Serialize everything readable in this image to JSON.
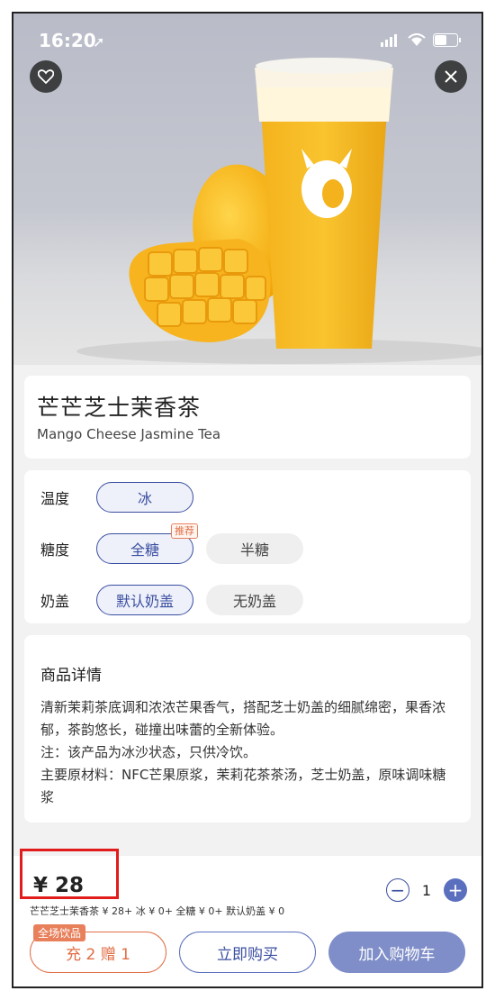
{
  "status_bar": {
    "time": "16:20"
  },
  "product": {
    "name_cn": "芒芒芝士茉香茶",
    "name_en": "Mango Cheese Jasmine Tea",
    "cup_brand": "luckin coffee"
  },
  "options": {
    "temperature": {
      "label": "温度",
      "choices": [
        "冰"
      ],
      "selected": "冰"
    },
    "sugar": {
      "label": "糖度",
      "choices": [
        "全糖",
        "半糖"
      ],
      "selected": "全糖",
      "recommend_tag": "推荐"
    },
    "cheese_cap": {
      "label": "奶盖",
      "choices": [
        "默认奶盖",
        "无奶盖"
      ],
      "selected": "默认奶盖"
    }
  },
  "details": {
    "title": "商品详情",
    "line1": "清新茉莉茶底调和浓浓芒果香气，搭配芝士奶盖的细腻绵密，果香浓郁，茶韵悠长，碰撞出味蕾的全新体验。",
    "line2": "注：该产品为冰沙状态，只供冷饮。",
    "line3": "主要原材料：NFC芒果原浆，茉莉花茶茶汤，芝士奶盖，原味调味糖浆"
  },
  "order": {
    "price": "¥ 28",
    "summary": "芒芒芝士茉香茶 ¥ 28+ 冰 ¥ 0+ 全糖 ¥ 0+ 默认奶盖 ¥ 0",
    "quantity": "1",
    "minus": "−",
    "plus": "+"
  },
  "buttons": {
    "all_drinks_tag": "全场饮品",
    "recharge": "充 2 赠 1",
    "buy_now": "立即购买",
    "add_to_cart": "加入购物车"
  },
  "colors": {
    "accent": "#3a4ea0",
    "cart_button": "#7f8ec8",
    "promo": "#e06e45",
    "highlight_box": "#e21c1c"
  }
}
